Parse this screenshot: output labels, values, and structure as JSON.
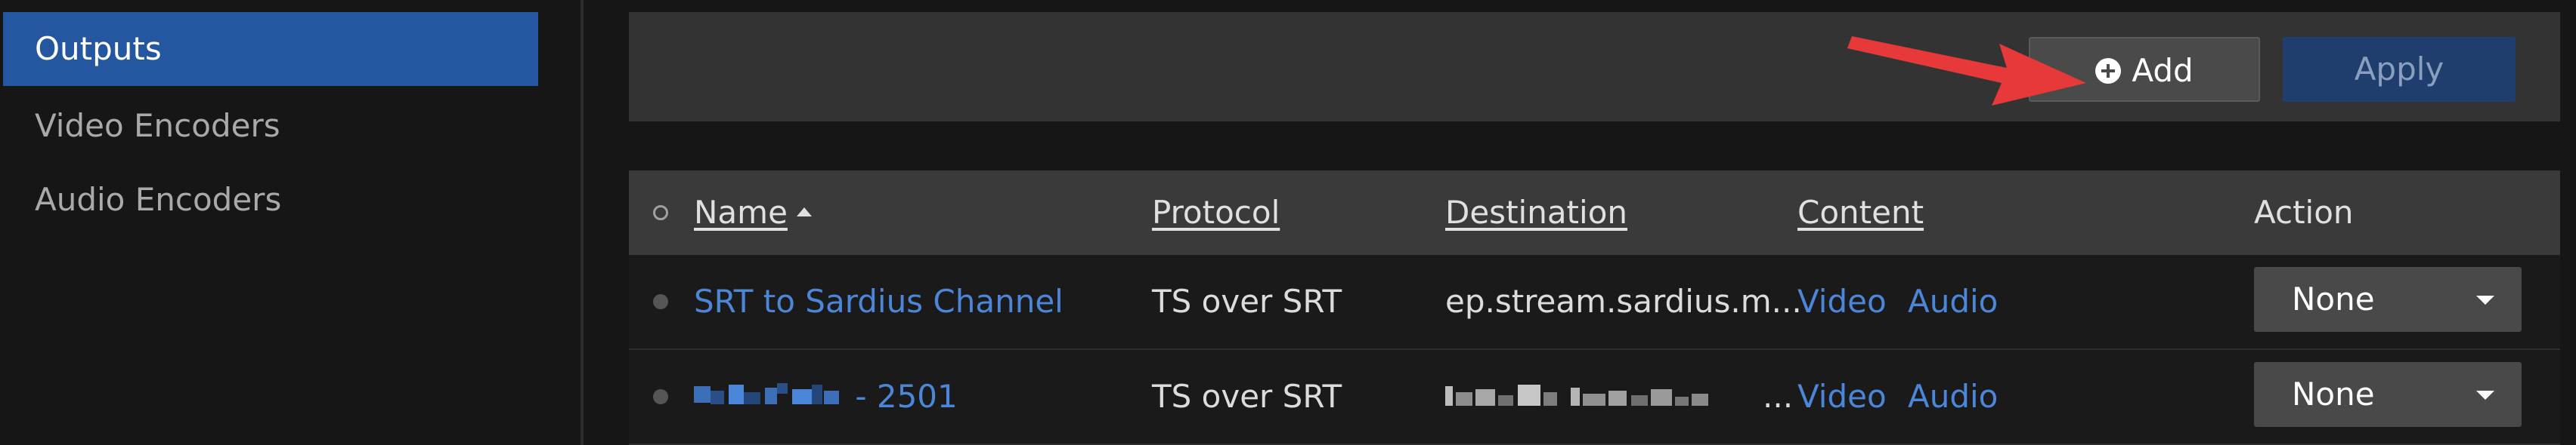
{
  "sidebar": {
    "items": [
      {
        "label": "Outputs",
        "active": true
      },
      {
        "label": "Video Encoders",
        "active": false
      },
      {
        "label": "Audio Encoders",
        "active": false
      }
    ]
  },
  "toolbar": {
    "add_label": "Add",
    "apply_label": "Apply"
  },
  "table": {
    "headers": {
      "name": "Name",
      "protocol": "Protocol",
      "destination": "Destination",
      "content": "Content",
      "action": "Action"
    },
    "rows": [
      {
        "name": "SRT to Sardius Channel",
        "protocol": "TS over SRT",
        "destination": "ep.stream.sardius.m...",
        "content_video": "Video",
        "content_audio": "Audio",
        "action": "None"
      },
      {
        "name_suffix": "- 2501",
        "protocol": "TS over SRT",
        "destination_suffix": "...",
        "content_video": "Video",
        "content_audio": "Audio",
        "action": "None"
      }
    ]
  },
  "colors": {
    "accent": "#2556a0",
    "link": "#4c86d8",
    "annotation": "#e8393a"
  }
}
